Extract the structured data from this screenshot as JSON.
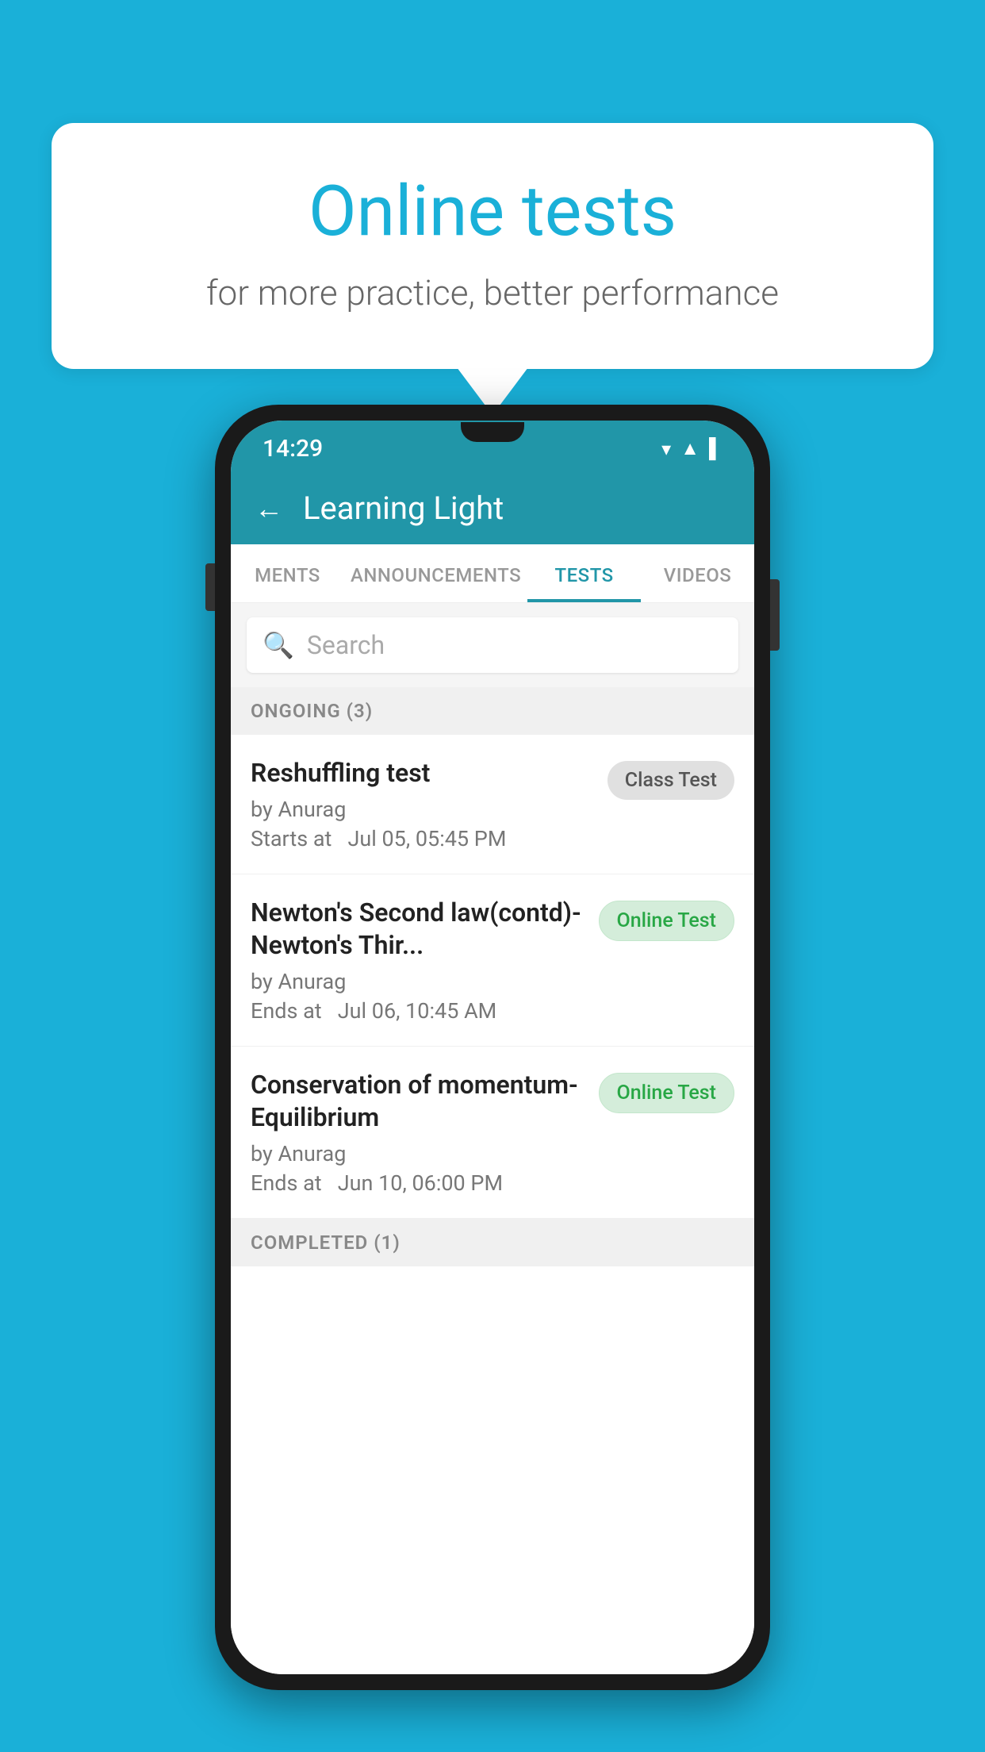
{
  "background_color": "#1ab0d8",
  "speech_bubble": {
    "title": "Online tests",
    "subtitle": "for more practice, better performance"
  },
  "phone": {
    "status_bar": {
      "time": "14:29",
      "wifi_icon": "▼",
      "signal_icon": "▲",
      "battery_icon": "▌"
    },
    "app_bar": {
      "back_label": "←",
      "title": "Learning Light"
    },
    "tabs": [
      {
        "label": "MENTS",
        "active": false
      },
      {
        "label": "ANNOUNCEMENTS",
        "active": false
      },
      {
        "label": "TESTS",
        "active": true
      },
      {
        "label": "VIDEOS",
        "active": false
      }
    ],
    "search": {
      "placeholder": "Search"
    },
    "ongoing_section": {
      "label": "ONGOING (3)",
      "tests": [
        {
          "name": "Reshuffling test",
          "by": "by Anurag",
          "date_label": "Starts at",
          "date": "Jul 05, 05:45 PM",
          "badge": "Class Test",
          "badge_type": "class"
        },
        {
          "name": "Newton's Second law(contd)-Newton's Thir...",
          "by": "by Anurag",
          "date_label": "Ends at",
          "date": "Jul 06, 10:45 AM",
          "badge": "Online Test",
          "badge_type": "online"
        },
        {
          "name": "Conservation of momentum-Equilibrium",
          "by": "by Anurag",
          "date_label": "Ends at",
          "date": "Jun 10, 06:00 PM",
          "badge": "Online Test",
          "badge_type": "online"
        }
      ]
    },
    "completed_section": {
      "label": "COMPLETED (1)"
    }
  }
}
